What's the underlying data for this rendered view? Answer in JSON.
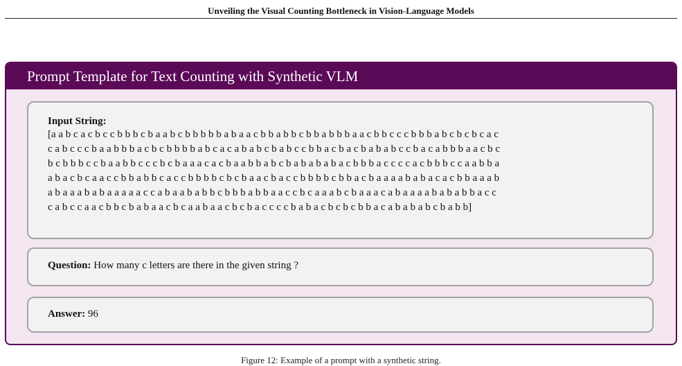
{
  "header": {
    "title": "Unveiling the Visual Counting Bottleneck in Vision-Language Models"
  },
  "template_box": {
    "title": "Prompt Template for Text Counting with Synthetic VLM",
    "input": {
      "label": "Input String:",
      "lines": [
        "[a a b c a c b c c b b b c b a a b c b b b b b a b a a c b b a b b c b b a b b b a a c b b c c c b b b a b c b c b c a c",
        "c a b c c c b a a b b b a c b c b b b b a b c a c a b a b c b a b c c b b a c b a c b a b a b c c b a c a b b b a a c b c",
        "b c b b b c c b a a b b c c c b c b a a a c a c b a a b b a b c b a b a b a b a c b b b a c c c c a c b b b c c a a b b a",
        "a b a c b c a a c c b b a b b c a c c b b b b c b c b a a c b a c c b b b b c b b a c b a a a a b a b a c a c b b a a a b",
        "a b a a a b a b a a a a a c c a b a a b a b b c b b b a b b a a c c b c a a a b c b a a a c a b a a a a b a b a b b a c c",
        "c a b c c a a c b b c b a b a a c b c a a b a a c b c b a c c c c b a b a c b c b c b b a c a b a b a b c b a b b]"
      ]
    },
    "question": {
      "label": "Question:",
      "text": "How many c letters are there in the given string ?"
    },
    "answer": {
      "label": "Answer:",
      "text": "96"
    }
  },
  "caption": "Figure 12: Example of a prompt with a synthetic string."
}
